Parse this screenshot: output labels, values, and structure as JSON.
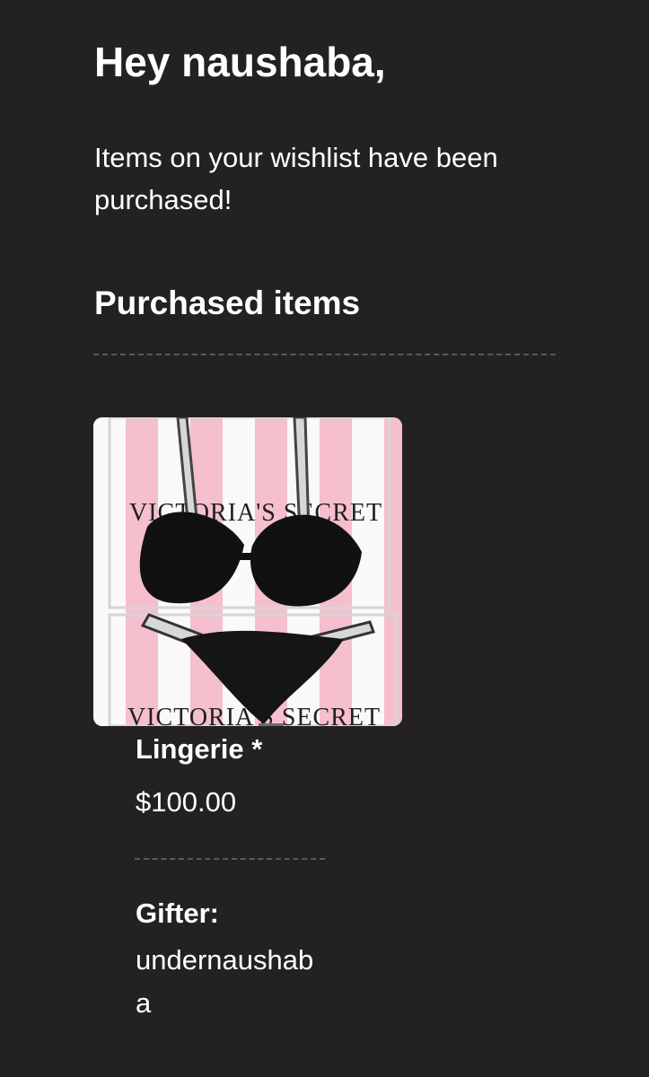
{
  "email": {
    "greeting": "Hey naushaba,",
    "message": "Items on your wishlist have been purchased!",
    "section_title": "Purchased items"
  },
  "items": [
    {
      "name": "Lingerie *",
      "price": "$100.00",
      "image": {
        "alt": "Product photo",
        "brand_text": "VICTORIA'S SECRET"
      },
      "gifter_label": "Gifter:",
      "gifter_name": "undernaushaba"
    }
  ],
  "colors": {
    "background": "#232221",
    "text": "#ffffff",
    "divider": "#5b5a58",
    "pink_stripe": "#f5bfce",
    "white_stripe": "#faf8f8"
  }
}
